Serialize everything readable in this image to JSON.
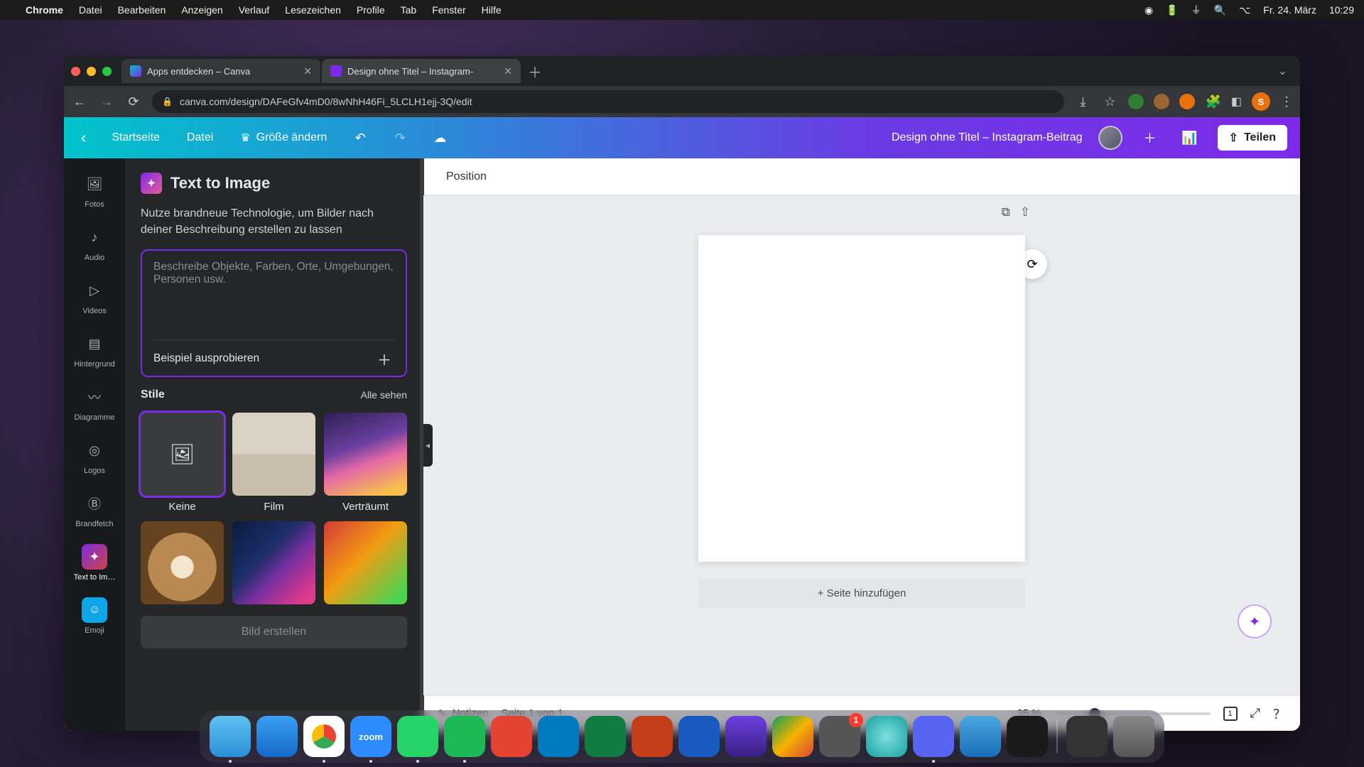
{
  "menubar": {
    "app": "Chrome",
    "items": [
      "Datei",
      "Bearbeiten",
      "Anzeigen",
      "Verlauf",
      "Lesezeichen",
      "Profile",
      "Tab",
      "Fenster",
      "Hilfe"
    ],
    "date": "Fr. 24. März",
    "time": "10:29"
  },
  "tabs": [
    {
      "title": "Apps entdecken – Canva",
      "active": false
    },
    {
      "title": "Design ohne Titel – Instagram-",
      "active": true
    }
  ],
  "url": "canva.com/design/DAFeGfv4mD0/8wNhH46Fi_5LCLH1ejj-3Q/edit",
  "canva": {
    "home": "Startseite",
    "file": "Datei",
    "resize": "Größe ändern",
    "doc_title": "Design ohne Titel – Instagram-Beitrag",
    "share": "Teilen"
  },
  "rail": {
    "fotos": "Fotos",
    "audio": "Audio",
    "videos": "Videos",
    "hintergrund": "Hintergrund",
    "diagramme": "Diagramme",
    "logos": "Logos",
    "brandfetch": "Brandfetch",
    "text_to_image": "Text to Im…",
    "emoji": "Emoji"
  },
  "panel": {
    "title": "Text to Image",
    "desc": "Nutze brandneue Technologie, um Bilder nach deiner Beschreibung erstellen zu lassen",
    "placeholder": "Beschreibe Objekte, Farben, Orte, Umgebungen, Personen usw.",
    "example": "Beispiel ausprobieren",
    "styles_label": "Stile",
    "see_all": "Alle sehen",
    "styles": [
      "Keine",
      "Film",
      "Verträumt"
    ],
    "generate": "Bild erstellen"
  },
  "stage": {
    "position": "Position",
    "add_page": "+ Seite hinzufügen",
    "notes": "Notizen",
    "page_of": "Seite 1 von 1",
    "zoom": "35 %",
    "page_count": "1"
  },
  "dock_badge": "1"
}
